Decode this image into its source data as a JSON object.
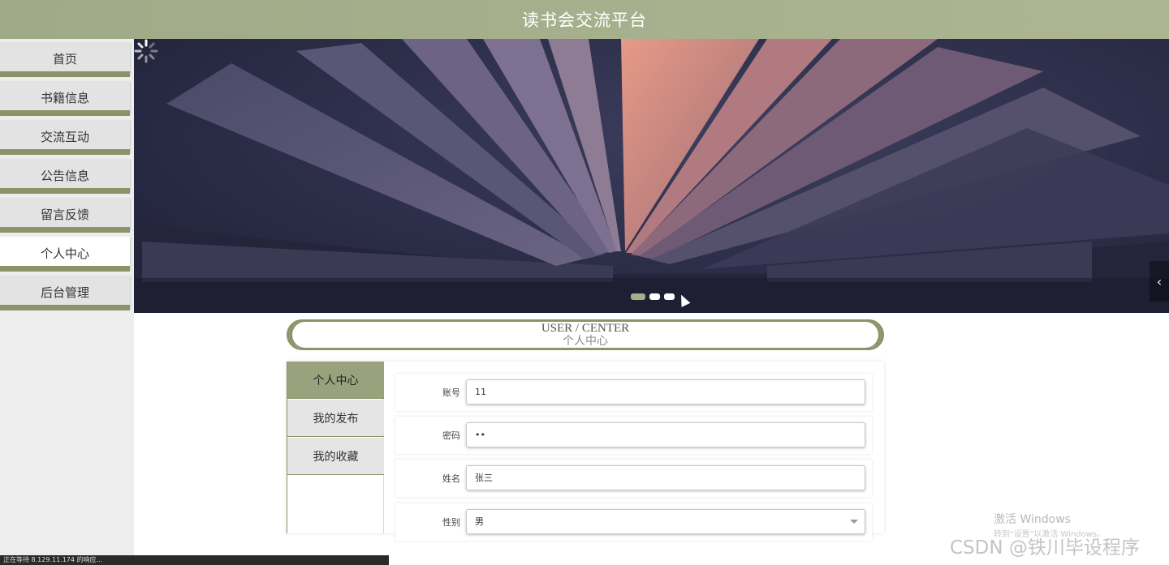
{
  "header": {
    "title": "读书会交流平台"
  },
  "nav": {
    "items": [
      {
        "label": "首页",
        "active": false
      },
      {
        "label": "书籍信息",
        "active": false
      },
      {
        "label": "交流互动",
        "active": false
      },
      {
        "label": "公告信息",
        "active": false
      },
      {
        "label": "留言反馈",
        "active": false
      },
      {
        "label": "个人中心",
        "active": true
      },
      {
        "label": "后台管理",
        "active": false
      }
    ]
  },
  "banner": {
    "slide_count": 3,
    "active_slide": 1,
    "prev_icon": "chevron-left-icon",
    "loading_icon": "spinner-icon"
  },
  "section": {
    "title_en": "USER / CENTER",
    "title_cn": "个人中心"
  },
  "user_menu": {
    "items": [
      {
        "label": "个人中心",
        "active": true
      },
      {
        "label": "我的发布",
        "active": false
      },
      {
        "label": "我的收藏",
        "active": false
      }
    ]
  },
  "form": {
    "account": {
      "label": "账号",
      "value": "11"
    },
    "password": {
      "label": "密码",
      "value": "••"
    },
    "name": {
      "label": "姓名",
      "value": "张三"
    },
    "gender": {
      "label": "性别",
      "value": "男"
    }
  },
  "watermark": {
    "line1": "激活 Windows",
    "line2": "转到\"设置\"以激活 Windows。",
    "csdn": "CSDN @铁川毕设程序"
  },
  "status": {
    "text": "正在等待 8.129.11.174 的响应..."
  },
  "colors": {
    "accent": "#8a9468",
    "header": "#a8b08c",
    "active_menu": "#9aa27d"
  }
}
